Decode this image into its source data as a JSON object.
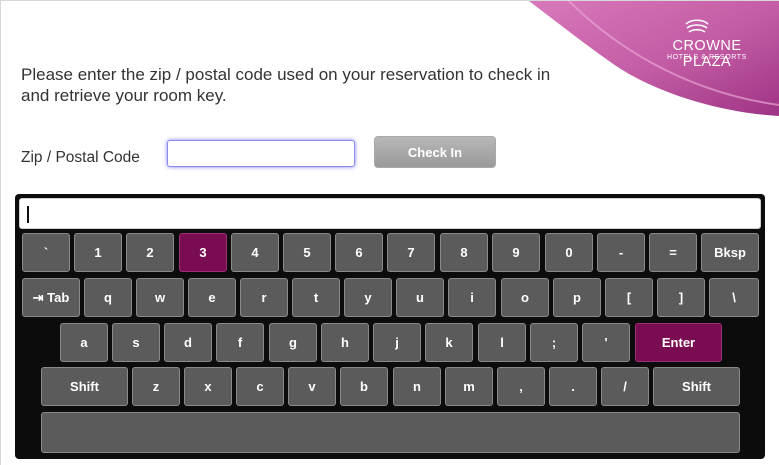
{
  "brand": {
    "name": "CROWNE PLAZA",
    "sub": "HOTELS & RESORTS",
    "accent_color": "#c45aa4",
    "icon": "crowne-plaza-wave-logo"
  },
  "instructions": "Please enter the zip / postal code used on your reservation to check in and retrieve your room key.",
  "form": {
    "zip_label": "Zip / Postal Code",
    "zip_value": "",
    "checkin_label": "Check In"
  },
  "keyboard": {
    "display_value": "",
    "highlight_color": "#7a0d52",
    "active_keys": [
      "3",
      "Enter"
    ],
    "rows": [
      [
        "`",
        "1",
        "2",
        "3",
        "4",
        "5",
        "6",
        "7",
        "8",
        "9",
        "0",
        "-",
        "=",
        "Bksp"
      ],
      [
        "⇥ Tab",
        "q",
        "w",
        "e",
        "r",
        "t",
        "y",
        "u",
        "i",
        "o",
        "p",
        "[",
        "]",
        "\\"
      ],
      [
        "a",
        "s",
        "d",
        "f",
        "g",
        "h",
        "j",
        "k",
        "l",
        ";",
        "'",
        "Enter"
      ],
      [
        "Shift",
        "z",
        "x",
        "c",
        "v",
        "b",
        "n",
        "m",
        ",",
        ".",
        "/",
        "Shift"
      ],
      [
        " "
      ]
    ]
  }
}
